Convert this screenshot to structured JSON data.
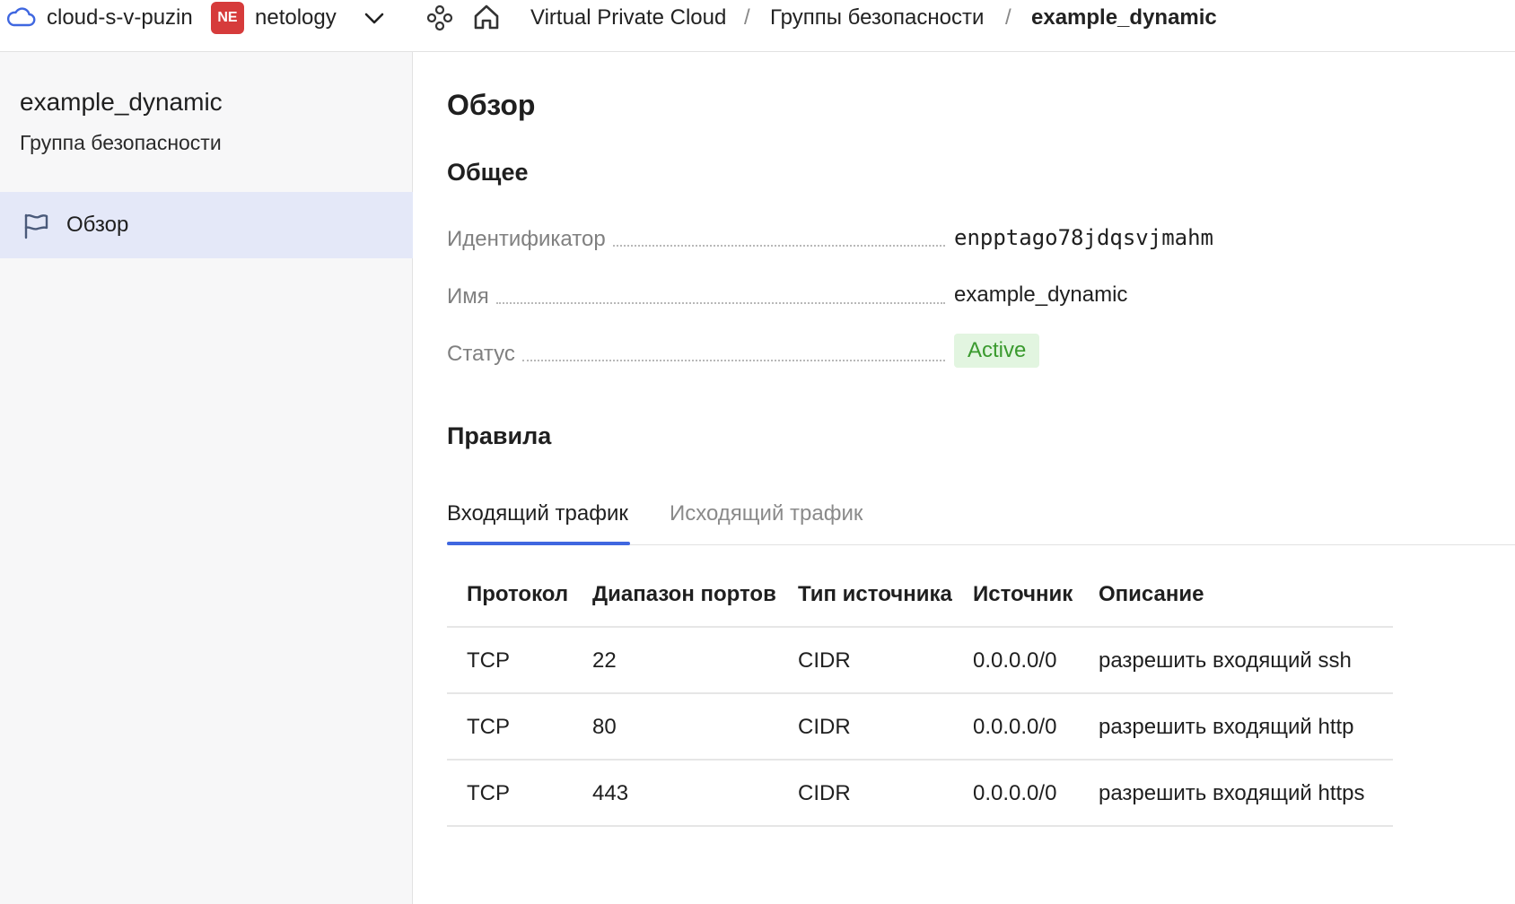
{
  "header": {
    "cloud_name": "cloud-s-v-puzin",
    "org_badge": "NE",
    "org_name": "netology",
    "breadcrumbs": [
      "Virtual Private Cloud",
      "Группы безопасности",
      "example_dynamic"
    ],
    "separator": "/"
  },
  "sidebar": {
    "resource_title": "example_dynamic",
    "resource_subtitle": "Группа безопасности",
    "items": [
      {
        "label": "Обзор",
        "icon": "flag-icon",
        "active": true
      }
    ]
  },
  "main": {
    "page_title": "Обзор",
    "general": {
      "title": "Общее",
      "id_label": "Идентификатор",
      "id_value": "enpptago78jdqsvjmahm",
      "name_label": "Имя",
      "name_value": "example_dynamic",
      "status_label": "Статус",
      "status_value": "Active"
    },
    "rules": {
      "title": "Правила",
      "tabs": [
        {
          "label": "Входящий трафик",
          "active": true
        },
        {
          "label": "Исходящий трафик",
          "active": false
        }
      ],
      "columns": [
        "Протокол",
        "Диапазон портов",
        "Тип источника",
        "Источник",
        "Описание"
      ],
      "rows": [
        [
          "TCP",
          "22",
          "CIDR",
          "0.0.0.0/0",
          "разрешить входящий ssh"
        ],
        [
          "TCP",
          "80",
          "CIDR",
          "0.0.0.0/0",
          "разрешить входящий http"
        ],
        [
          "TCP",
          "443",
          "CIDR",
          "0.0.0.0/0",
          "разрешить входящий https"
        ]
      ]
    }
  },
  "colors": {
    "accent": "#3f67e0",
    "org_badge": "#d63b3b",
    "status_active_bg": "#e2f5e0",
    "status_active_text": "#3a9a2e",
    "sidebar_active_bg": "#e4e8f8"
  }
}
